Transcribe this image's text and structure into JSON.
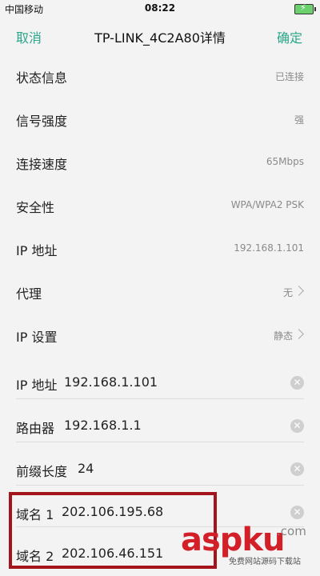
{
  "status_bar": {
    "carrier": "中国移动",
    "time": "08:22"
  },
  "header": {
    "cancel": "取消",
    "title": "TP-LINK_4C2A80详情",
    "confirm": "确定"
  },
  "info_rows": [
    {
      "label": "状态信息",
      "value": "已连接"
    },
    {
      "label": "信号强度",
      "value": "强"
    },
    {
      "label": "连接速度",
      "value": "65Mbps"
    },
    {
      "label": "安全性",
      "value": "WPA/WPA2 PSK"
    },
    {
      "label": "IP 地址",
      "value": "192.168.1.101"
    },
    {
      "label": "代理",
      "value": "无"
    },
    {
      "label": "IP 设置",
      "value": "静态"
    }
  ],
  "static_fields": [
    {
      "label": "IP 地址",
      "value": "192.168.1.101"
    },
    {
      "label": "路由器",
      "value": "192.168.1.1"
    },
    {
      "label": "前缀长度",
      "value": "24"
    },
    {
      "label": "域名 1",
      "value": "202.106.195.68"
    },
    {
      "label": "域名 2",
      "value": "202.106.46.151"
    }
  ],
  "watermark": {
    "main": "aspku",
    "suffix": ".com",
    "sub": "免费网站源码下载站"
  },
  "colors": {
    "accent": "#2aa68a",
    "highlight": "#a3151a",
    "watermark": "#d21f28"
  }
}
